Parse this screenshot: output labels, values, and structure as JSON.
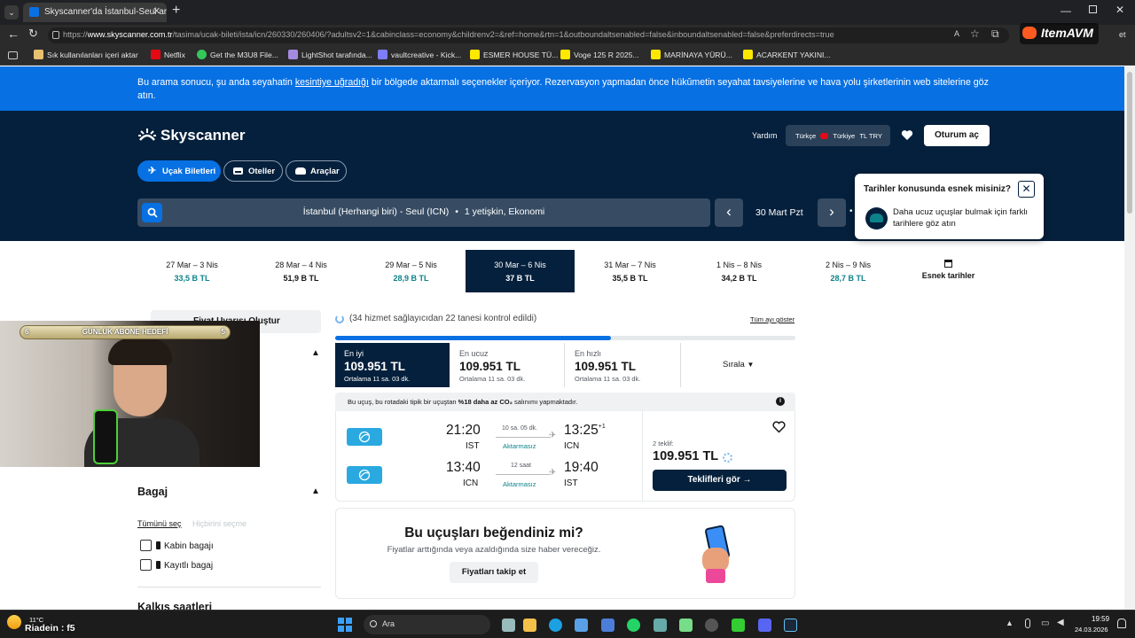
{
  "browser": {
    "tab_title": "Skyscanner'da İstanbul-Seul arası",
    "url_prefix": "https://",
    "url_domain": "www.skyscanner.com.tr",
    "url_rest": "/tasima/ucak-bileti/ista/icn/260330/260406/?adultsv2=1&cabinclass=economy&childrenv2=&ref=home&rtn=1&outboundaltsenabled=false&inboundaltsenabled=false&preferdirects=true",
    "bookmarks": [
      "Sık kullanılanları içeri aktar",
      "Netflix",
      "Get the M3U8 File...",
      "LightShot tarafında...",
      "vaultcreative - Kick...",
      "ESMER HOUSE TÜ...",
      "Voge 125 R 2025...",
      "MARİNAYA YÜRÜ...",
      "ACARKENT YAKINI..."
    ],
    "profile_label": "et"
  },
  "notice": {
    "pre": "Bu arama sonucu, şu anda seyahatin ",
    "link": "kesintiye uğradığı",
    "post": " bir bölgede aktarmalı seçenekler içeriyor. Rezervasyon yapmadan önce hükûmetin seyahat tavsiyelerine ve hava yolu şirketlerinin web sitelerine göz atın."
  },
  "header": {
    "brand": "Skyscanner",
    "help": "Yardım",
    "locale_lang": "Türkçe",
    "locale_country": "Türkiye",
    "locale_currency": "TL TRY",
    "login": "Oturum aç",
    "tabs": [
      "Uçak Biletleri",
      "Oteller",
      "Araçlar"
    ],
    "search_summary": "İstanbul (Herhangi biri) - Seul (ICN)",
    "search_pax": "1 yetişkin, Ekonomi",
    "search_date": "30 Mart Pzt"
  },
  "popup": {
    "title": "Tarihler konusunda esnek misiniz?",
    "body": "Daha ucuz uçuşlar bulmak için farklı tarihlere göz atın"
  },
  "dates": [
    {
      "range": "27 Mar – 3 Nis",
      "price": "33,5 B TL",
      "color": "green"
    },
    {
      "range": "28 Mar – 4 Nis",
      "price": "51,9 B TL",
      "color": "dark"
    },
    {
      "range": "29 Mar – 5 Nis",
      "price": "28,9 B TL",
      "color": "green"
    },
    {
      "range": "30 Mar – 6 Nis",
      "price": "37 B TL",
      "color": "selected"
    },
    {
      "range": "31 Mar – 7 Nis",
      "price": "35,5 B TL",
      "color": "dark"
    },
    {
      "range": "1 Nis – 8 Nis",
      "price": "34,2 B TL",
      "color": "dark"
    },
    {
      "range": "2 Nis – 9 Nis",
      "price": "28,7 B TL",
      "color": "green"
    }
  ],
  "flex_dates": "Esnek tarihler",
  "results": {
    "providers": "(34 hizmet sağlayıcıdan 22 tanesi kontrol edildi)",
    "show_all_month": "Tüm ayı göster",
    "progress": 0.6,
    "alert_fragment": "Fiyat Uyarısı Oluştur",
    "sort": [
      {
        "label": "En iyi",
        "price": "109.951 TL",
        "avg": "Ortalama 11 sa. 03 dk."
      },
      {
        "label": "En ucuz",
        "price": "109.951 TL",
        "avg": "Ortalama 11 sa. 03 dk."
      },
      {
        "label": "En hızlı",
        "price": "109.951 TL",
        "avg": "Ortalama 11 sa. 03 dk."
      }
    ],
    "sort_by": "Sırala",
    "co2_pre": "Bu uçuş, bu rotadaki tipik bir uçuştan ",
    "co2_bold": "%18 daha az CO₂",
    "co2_post": " salınımı yapmaktadır.",
    "out": {
      "dep": "21:20",
      "dep_code": "IST",
      "dur": "10 sa. 05 dk.",
      "type": "Aktarmasız",
      "arr": "13:25",
      "arr_sup": "+1",
      "arr_code": "ICN"
    },
    "ret": {
      "dep": "13:40",
      "dep_code": "ICN",
      "dur": "12 saat",
      "type": "Aktarmasız",
      "arr": "19:40",
      "arr_code": "IST"
    },
    "offers": "2 teklif:",
    "price": "109.951 TL",
    "cta": "Teklifleri gör →",
    "promo_title": "Bu uçuşları beğendiniz mi?",
    "promo_body": "Fiyatlar arttığında veya azaldığında size haber vereceğiz.",
    "promo_btn": "Fiyatları takip et"
  },
  "filters": {
    "baggage": "Bagaj",
    "select_all": "Tümünü seç",
    "select_none": "Hiçbirini seçme",
    "cabin": "Kabin bagajı",
    "checked": "Kayıtlı bagaj",
    "next_section": "Kalkış saatleri"
  },
  "stream": {
    "goal": "GÜNLÜK ABONE HEDEFİ",
    "goal_left": "6",
    "goal_right": "5",
    "overlay_brand": "ItemAVM"
  },
  "taskbar": {
    "temp": "11°C",
    "user": "Riadein : f5",
    "search": "Ara",
    "time": "19:59",
    "date": "24.03.2026"
  }
}
